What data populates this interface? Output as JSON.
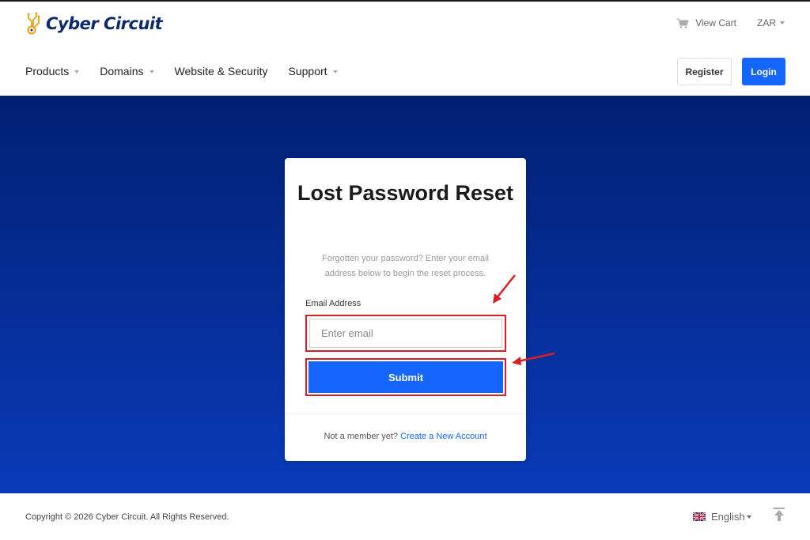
{
  "brand": {
    "name": "Cyber Circuit"
  },
  "topbar": {
    "view_cart": "View Cart",
    "currency": "ZAR"
  },
  "nav": {
    "items": [
      {
        "label": "Products",
        "dropdown": true
      },
      {
        "label": "Domains",
        "dropdown": true
      },
      {
        "label": "Website & Security",
        "dropdown": false
      },
      {
        "label": "Support",
        "dropdown": true
      }
    ]
  },
  "auth": {
    "register": "Register",
    "login": "Login"
  },
  "card": {
    "title": "Lost Password Reset",
    "description": "Forgotten your password? Enter your email address below to begin the reset process.",
    "email_label": "Email Address",
    "email_placeholder": "Enter email",
    "email_value": "",
    "submit": "Submit",
    "footer_text": "Not a member yet?",
    "footer_link": "Create a New Account"
  },
  "footer": {
    "copyright": "Copyright © 2026 Cyber Circuit. All Rights Reserved.",
    "language": "English"
  },
  "colors": {
    "accent": "#1565ff",
    "hero_top": "#002073",
    "hero_bottom": "#0a3ab8",
    "annotation": "#d81f26",
    "brand_text": "#0d2a6e",
    "brand_gold": "#e8a317"
  },
  "icons": {
    "cart": "cart-icon",
    "flag": "uk-flag-icon",
    "back_to_top": "arrow-up-icon"
  }
}
